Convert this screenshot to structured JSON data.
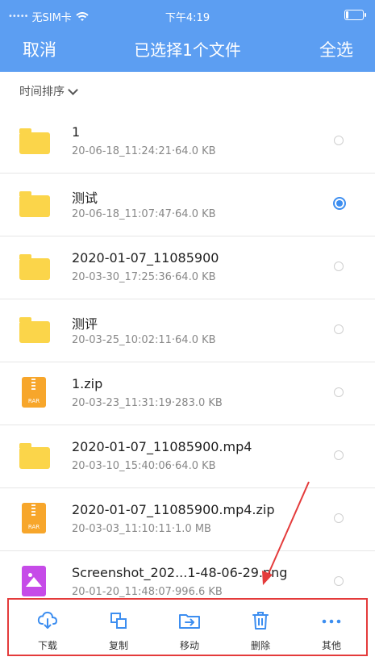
{
  "status": {
    "carrier": "无SIM卡",
    "time": "下午4:19"
  },
  "header": {
    "cancel": "取消",
    "title": "已选择1个文件",
    "select_all": "全选"
  },
  "sort": {
    "label": "时间排序"
  },
  "files": [
    {
      "name": "1",
      "meta": "20-06-18_11:24:21·64.0 KB",
      "type": "folder",
      "selected": false
    },
    {
      "name": "测试",
      "meta": "20-06-18_11:07:47·64.0 KB",
      "type": "folder",
      "selected": true
    },
    {
      "name": "2020-01-07_11085900",
      "meta": "20-03-30_17:25:36·64.0 KB",
      "type": "folder",
      "selected": false
    },
    {
      "name": "测评",
      "meta": "20-03-25_10:02:11·64.0 KB",
      "type": "folder",
      "selected": false
    },
    {
      "name": "1.zip",
      "meta": "20-03-23_11:31:19·283.0 KB",
      "type": "rar",
      "selected": false
    },
    {
      "name": "2020-01-07_11085900.mp4",
      "meta": "20-03-10_15:40:06·64.0 KB",
      "type": "folder",
      "selected": false
    },
    {
      "name": "2020-01-07_11085900.mp4.zip",
      "meta": "20-03-03_11:10:11·1.0 MB",
      "type": "rar",
      "selected": false
    },
    {
      "name": "Screenshot_202...1-48-06-29.png",
      "meta": "20-01-20_11:48:07·996.6 KB",
      "type": "image",
      "selected": false
    }
  ],
  "toolbar": {
    "download": "下载",
    "copy": "复制",
    "move": "移动",
    "delete": "删除",
    "more": "其他"
  },
  "rar_label": "RAR",
  "colors": {
    "accent": "#3d8ef0",
    "header": "#5c9ef2",
    "highlight": "#e43b3b"
  }
}
